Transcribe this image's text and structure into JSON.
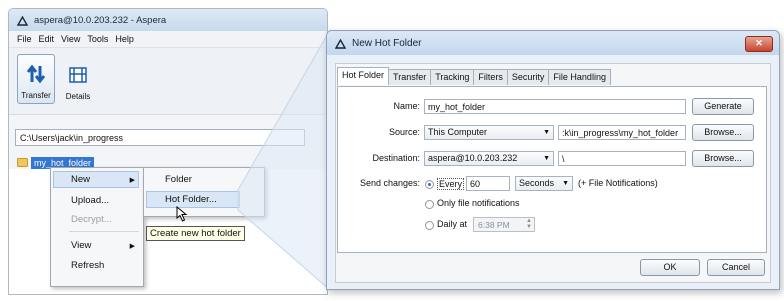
{
  "back_window": {
    "title": "aspera@10.0.203.232 - Aspera",
    "menu": [
      "File",
      "Edit",
      "View",
      "Tools",
      "Help"
    ],
    "toolbar": [
      {
        "label": "Transfer",
        "icon": "transfer-arrows-icon",
        "active": true
      },
      {
        "label": "Details",
        "icon": "details-icon",
        "active": false
      }
    ],
    "path": "C:\\Users\\jack\\in_progress",
    "tree_item": "my_hot_folder",
    "context_menu": {
      "new": "New",
      "upload": "Upload...",
      "decrypt": "Decrypt...",
      "view": "View",
      "refresh": "Refresh"
    },
    "submenu": {
      "folder": "Folder",
      "hot_folder": "Hot Folder..."
    },
    "tooltip": "Create new hot folder"
  },
  "dialog": {
    "title": "New Hot Folder",
    "tabs": [
      "Hot Folder",
      "Transfer",
      "Tracking",
      "Filters",
      "Security",
      "File Handling"
    ],
    "name_label": "Name:",
    "name_value": "my_hot_folder",
    "generate": "Generate",
    "source_label": "Source:",
    "source_select": "This Computer",
    "source_path": ":k\\in_progress\\my_hot_folder",
    "browse": "Browse...",
    "destination_label": "Destination:",
    "destination_select": "aspera@10.0.203.232",
    "destination_path": "\\",
    "send_changes_label": "Send changes:",
    "every_label": "Every",
    "every_value": "60",
    "unit_select": "Seconds",
    "file_notifications_suffix": "(+ File Notifications)",
    "only_notifications": "Only file notifications",
    "daily_at": "Daily at",
    "time_value": "6:38 PM",
    "ok": "OK",
    "cancel": "Cancel",
    "colors": {
      "accent": "#2f6fc7",
      "selection": "#3477d3",
      "close": "#c6452f"
    }
  }
}
